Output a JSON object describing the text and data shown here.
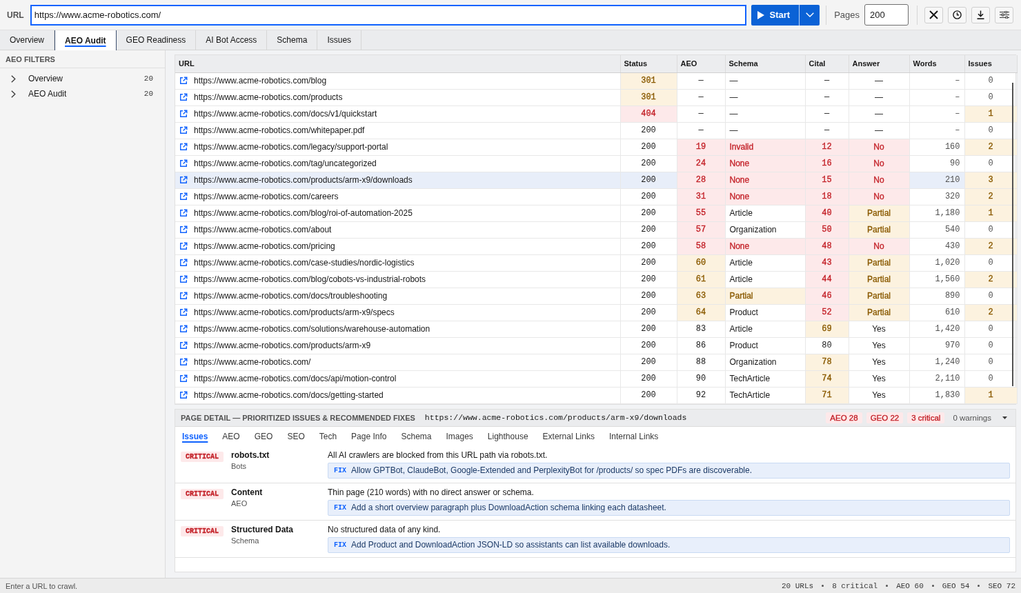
{
  "toolbar": {
    "url_label": "URL",
    "url_field": {
      "value": "https://www.acme-robotics.com/",
      "focused": true
    },
    "start_label": "Start",
    "pages_label": "Pages",
    "pages_value": "200"
  },
  "tabs": [
    {
      "label": "Overview",
      "selected": false
    },
    {
      "label": "AEO Audit",
      "selected": true
    },
    {
      "label": "GEO Readiness",
      "selected": false
    },
    {
      "label": "AI Bot Access",
      "selected": false
    },
    {
      "label": "Schema",
      "selected": false
    },
    {
      "label": "Issues",
      "selected": false
    }
  ],
  "sidebar": {
    "title": "AEO FILTERS",
    "items": [
      {
        "label": "Overview",
        "count": "20",
        "expanded": false
      },
      {
        "label": "AEO Audit",
        "count": "20",
        "expanded": false
      }
    ]
  },
  "table": {
    "columns": [
      "URL",
      "Status",
      "AEO",
      "Schema",
      "Cital",
      "Answer",
      "Words",
      "Issues"
    ],
    "rows": [
      {
        "selected": false,
        "cells": [
          {
            "text": "https://www.acme-robotics.com/blog"
          },
          {
            "text": "301",
            "color": "#8a5a00"
          },
          {
            "text": "—"
          },
          {
            "text": "—"
          },
          {
            "text": "—"
          },
          {
            "text": "—"
          },
          {
            "text": "–"
          },
          {
            "text": "0"
          }
        ]
      },
      {
        "selected": false,
        "cells": [
          {
            "text": "https://www.acme-robotics.com/products"
          },
          {
            "text": "301",
            "color": "#8a5a00"
          },
          {
            "text": "—"
          },
          {
            "text": "—"
          },
          {
            "text": "—"
          },
          {
            "text": "—"
          },
          {
            "text": "–"
          },
          {
            "text": "0"
          }
        ]
      },
      {
        "selected": false,
        "cells": [
          {
            "text": "https://www.acme-robotics.com/docs/v1/quickstart"
          },
          {
            "text": "404",
            "color": "#c4242b"
          },
          {
            "text": "—"
          },
          {
            "text": "—"
          },
          {
            "text": "—"
          },
          {
            "text": "—"
          },
          {
            "text": "–"
          },
          {
            "text": "1",
            "color": "#8a5a00"
          }
        ]
      },
      {
        "selected": false,
        "cells": [
          {
            "text": "https://www.acme-robotics.com/whitepaper.pdf"
          },
          {
            "text": "200"
          },
          {
            "text": "—"
          },
          {
            "text": "—"
          },
          {
            "text": "—"
          },
          {
            "text": "—"
          },
          {
            "text": "–"
          },
          {
            "text": "0"
          }
        ]
      },
      {
        "selected": false,
        "cells": [
          {
            "text": "https://www.acme-robotics.com/legacy/support-portal"
          },
          {
            "text": "200"
          },
          {
            "text": "19",
            "color": "#c4242b"
          },
          {
            "text": "Invalid",
            "color": "#c4242b"
          },
          {
            "text": "12",
            "color": "#c4242b"
          },
          {
            "text": "No",
            "color": "#c4242b"
          },
          {
            "text": "160"
          },
          {
            "text": "2",
            "color": "#8a5a00"
          }
        ]
      },
      {
        "selected": false,
        "cells": [
          {
            "text": "https://www.acme-robotics.com/tag/uncategorized"
          },
          {
            "text": "200"
          },
          {
            "text": "24",
            "color": "#c4242b"
          },
          {
            "text": "None",
            "color": "#c4242b"
          },
          {
            "text": "16",
            "color": "#c4242b"
          },
          {
            "text": "No",
            "color": "#c4242b"
          },
          {
            "text": "90"
          },
          {
            "text": "0"
          }
        ]
      },
      {
        "selected": true,
        "cells": [
          {
            "text": "https://www.acme-robotics.com/products/arm-x9/downloads"
          },
          {
            "text": "200"
          },
          {
            "text": "28",
            "color": "#c4242b"
          },
          {
            "text": "None",
            "color": "#c4242b"
          },
          {
            "text": "15",
            "color": "#c4242b"
          },
          {
            "text": "No",
            "color": "#c4242b"
          },
          {
            "text": "210"
          },
          {
            "text": "3",
            "color": "#8a5a00"
          }
        ]
      },
      {
        "selected": false,
        "cells": [
          {
            "text": "https://www.acme-robotics.com/careers"
          },
          {
            "text": "200"
          },
          {
            "text": "31",
            "color": "#c4242b"
          },
          {
            "text": "None",
            "color": "#c4242b"
          },
          {
            "text": "18",
            "color": "#c4242b"
          },
          {
            "text": "No",
            "color": "#c4242b"
          },
          {
            "text": "320"
          },
          {
            "text": "2",
            "color": "#8a5a00"
          }
        ]
      },
      {
        "selected": false,
        "cells": [
          {
            "text": "https://www.acme-robotics.com/blog/roi-of-automation-2025"
          },
          {
            "text": "200"
          },
          {
            "text": "55",
            "color": "#c4242b"
          },
          {
            "text": "Article"
          },
          {
            "text": "40",
            "color": "#c4242b"
          },
          {
            "text": "Partial",
            "color": "#8a5a00"
          },
          {
            "text": "1,180"
          },
          {
            "text": "1",
            "color": "#8a5a00"
          }
        ]
      },
      {
        "selected": false,
        "cells": [
          {
            "text": "https://www.acme-robotics.com/about"
          },
          {
            "text": "200"
          },
          {
            "text": "57",
            "color": "#c4242b"
          },
          {
            "text": "Organization"
          },
          {
            "text": "50",
            "color": "#c4242b"
          },
          {
            "text": "Partial",
            "color": "#8a5a00"
          },
          {
            "text": "540"
          },
          {
            "text": "0"
          }
        ]
      },
      {
        "selected": false,
        "cells": [
          {
            "text": "https://www.acme-robotics.com/pricing"
          },
          {
            "text": "200"
          },
          {
            "text": "58",
            "color": "#c4242b"
          },
          {
            "text": "None",
            "color": "#c4242b"
          },
          {
            "text": "48",
            "color": "#c4242b"
          },
          {
            "text": "No",
            "color": "#c4242b"
          },
          {
            "text": "430"
          },
          {
            "text": "2",
            "color": "#8a5a00"
          }
        ]
      },
      {
        "selected": false,
        "cells": [
          {
            "text": "https://www.acme-robotics.com/case-studies/nordic-logistics"
          },
          {
            "text": "200"
          },
          {
            "text": "60",
            "color": "#8a5a00"
          },
          {
            "text": "Article"
          },
          {
            "text": "43",
            "color": "#c4242b"
          },
          {
            "text": "Partial",
            "color": "#8a5a00"
          },
          {
            "text": "1,020"
          },
          {
            "text": "0"
          }
        ]
      },
      {
        "selected": false,
        "cells": [
          {
            "text": "https://www.acme-robotics.com/blog/cobots-vs-industrial-robots"
          },
          {
            "text": "200"
          },
          {
            "text": "61",
            "color": "#8a5a00"
          },
          {
            "text": "Article"
          },
          {
            "text": "44",
            "color": "#c4242b"
          },
          {
            "text": "Partial",
            "color": "#8a5a00"
          },
          {
            "text": "1,560"
          },
          {
            "text": "2",
            "color": "#8a5a00"
          }
        ]
      },
      {
        "selected": false,
        "cells": [
          {
            "text": "https://www.acme-robotics.com/docs/troubleshooting"
          },
          {
            "text": "200"
          },
          {
            "text": "63",
            "color": "#8a5a00"
          },
          {
            "text": "Partial",
            "color": "#8a5a00"
          },
          {
            "text": "46",
            "color": "#c4242b"
          },
          {
            "text": "Partial",
            "color": "#8a5a00"
          },
          {
            "text": "890"
          },
          {
            "text": "0"
          }
        ]
      },
      {
        "selected": false,
        "cells": [
          {
            "text": "https://www.acme-robotics.com/products/arm-x9/specs"
          },
          {
            "text": "200"
          },
          {
            "text": "64",
            "color": "#8a5a00"
          },
          {
            "text": "Product"
          },
          {
            "text": "52",
            "color": "#c4242b"
          },
          {
            "text": "Partial",
            "color": "#8a5a00"
          },
          {
            "text": "610"
          },
          {
            "text": "2",
            "color": "#8a5a00"
          }
        ]
      },
      {
        "selected": false,
        "cells": [
          {
            "text": "https://www.acme-robotics.com/solutions/warehouse-automation"
          },
          {
            "text": "200"
          },
          {
            "text": "83"
          },
          {
            "text": "Article"
          },
          {
            "text": "69",
            "color": "#8a5a00"
          },
          {
            "text": "Yes"
          },
          {
            "text": "1,420"
          },
          {
            "text": "0"
          }
        ]
      },
      {
        "selected": false,
        "cells": [
          {
            "text": "https://www.acme-robotics.com/products/arm-x9"
          },
          {
            "text": "200"
          },
          {
            "text": "86"
          },
          {
            "text": "Product"
          },
          {
            "text": "80"
          },
          {
            "text": "Yes"
          },
          {
            "text": "970"
          },
          {
            "text": "0"
          }
        ]
      },
      {
        "selected": false,
        "cells": [
          {
            "text": "https://www.acme-robotics.com/"
          },
          {
            "text": "200"
          },
          {
            "text": "88"
          },
          {
            "text": "Organization"
          },
          {
            "text": "78",
            "color": "#8a5a00"
          },
          {
            "text": "Yes"
          },
          {
            "text": "1,240"
          },
          {
            "text": "0"
          }
        ]
      },
      {
        "selected": false,
        "cells": [
          {
            "text": "https://www.acme-robotics.com/docs/api/motion-control"
          },
          {
            "text": "200"
          },
          {
            "text": "90"
          },
          {
            "text": "TechArticle"
          },
          {
            "text": "74",
            "color": "#8a5a00"
          },
          {
            "text": "Yes"
          },
          {
            "text": "2,110"
          },
          {
            "text": "0"
          }
        ]
      },
      {
        "selected": false,
        "cells": [
          {
            "text": "https://www.acme-robotics.com/docs/getting-started"
          },
          {
            "text": "200"
          },
          {
            "text": "92"
          },
          {
            "text": "TechArticle"
          },
          {
            "text": "71",
            "color": "#8a5a00"
          },
          {
            "text": "Yes"
          },
          {
            "text": "1,830"
          },
          {
            "text": "1",
            "color": "#8a5a00"
          }
        ]
      }
    ]
  },
  "page_detail": {
    "title": "PAGE DETAIL — PRIORITIZED ISSUES & RECOMMENDED FIXES",
    "url": "https://www.acme-robotics.com/products/arm-x9/downloads",
    "badges": [
      {
        "text": "AEO 28",
        "color": "#c4242b"
      },
      {
        "text": "GEO 22",
        "color": "#c4242b"
      },
      {
        "text": "3 critical",
        "color": "#c4242b"
      },
      {
        "text": "0 warnings"
      }
    ],
    "tabs": [
      {
        "label": "Issues",
        "selected": true
      },
      {
        "label": "AEO",
        "selected": false
      },
      {
        "label": "GEO",
        "selected": false
      },
      {
        "label": "SEO",
        "selected": false
      },
      {
        "label": "Tech",
        "selected": false
      },
      {
        "label": "Page Info",
        "selected": false
      },
      {
        "label": "Schema",
        "selected": false
      },
      {
        "label": "Images",
        "selected": false
      },
      {
        "label": "Lighthouse",
        "selected": false
      },
      {
        "label": "External Links",
        "selected": false
      },
      {
        "label": "Internal Links",
        "selected": false
      }
    ],
    "issues": [
      {
        "badge": "CRITICAL",
        "color": "#c4242b",
        "title": "robots.txt",
        "category": "Bots",
        "description": "All AI crawlers are blocked from this URL path via robots.txt.",
        "fix_label": "FIX",
        "fix": "Allow GPTBot, ClaudeBot, Google-Extended and PerplexityBot for /products/ so spec PDFs are discoverable."
      },
      {
        "badge": "CRITICAL",
        "color": "#c4242b",
        "title": "Content",
        "category": "AEO",
        "description": "Thin page (210 words) with no direct answer or schema.",
        "fix_label": "FIX",
        "fix": "Add a short overview paragraph plus DownloadAction schema linking each datasheet."
      },
      {
        "badge": "CRITICAL",
        "color": "#c4242b",
        "title": "Structured Data",
        "category": "Schema",
        "description": "No structured data of any kind.",
        "fix_label": "FIX",
        "fix": "Add Product and DownloadAction JSON-LD so assistants can list available downloads."
      }
    ]
  },
  "status_bar": {
    "message": "Enter a URL to crawl.",
    "stats": [
      "20 URLs",
      "8 critical",
      "AEO 60",
      "GEO 54",
      "SEO 72"
    ]
  }
}
